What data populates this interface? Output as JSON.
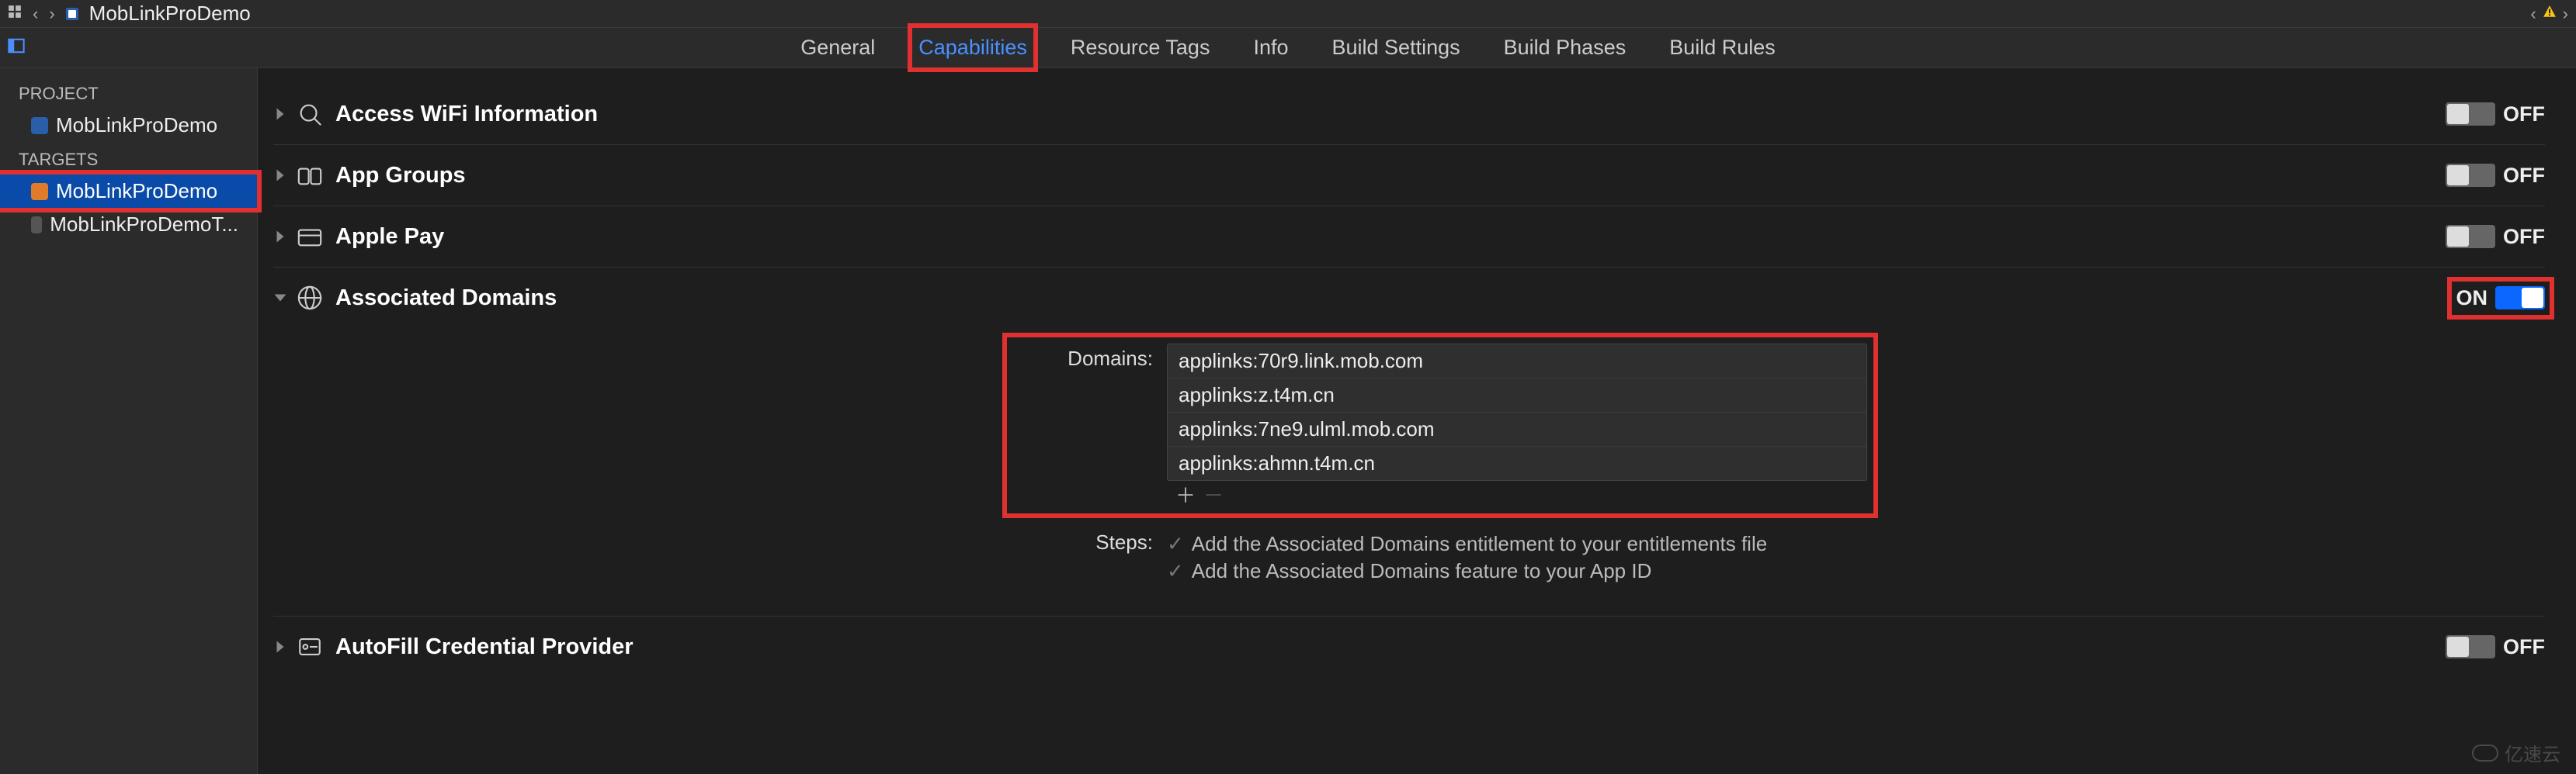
{
  "breadcrumb": {
    "project": "MobLinkProDemo"
  },
  "tabs": {
    "general": "General",
    "capabilities": "Capabilities",
    "resource_tags": "Resource Tags",
    "info": "Info",
    "build_settings": "Build Settings",
    "build_phases": "Build Phases",
    "build_rules": "Build Rules"
  },
  "sidebar": {
    "project_label": "PROJECT",
    "targets_label": "TARGETS",
    "project_name": "MobLinkProDemo",
    "targets": [
      {
        "name": "MobLinkProDemo",
        "selected": true
      },
      {
        "name": "MobLinkProDemoT...",
        "selected": false
      }
    ]
  },
  "capabilities": {
    "wifi": {
      "title": "Access WiFi Information",
      "state": "OFF"
    },
    "app_groups": {
      "title": "App Groups",
      "state": "OFF"
    },
    "apple_pay": {
      "title": "Apple Pay",
      "state": "OFF"
    },
    "assoc_domains": {
      "title": "Associated Domains",
      "state": "ON",
      "domains_label": "Domains:",
      "domains": [
        "applinks:70r9.link.mob.com",
        "applinks:z.t4m.cn",
        "applinks:7ne9.ulml.mob.com",
        "applinks:ahmn.t4m.cn"
      ],
      "steps_label": "Steps:",
      "steps": [
        "Add the Associated Domains entitlement to your entitlements file",
        "Add the Associated Domains feature to your App ID"
      ]
    },
    "autofill": {
      "title": "AutoFill Credential Provider",
      "state": "OFF"
    }
  },
  "watermark": "亿速云"
}
